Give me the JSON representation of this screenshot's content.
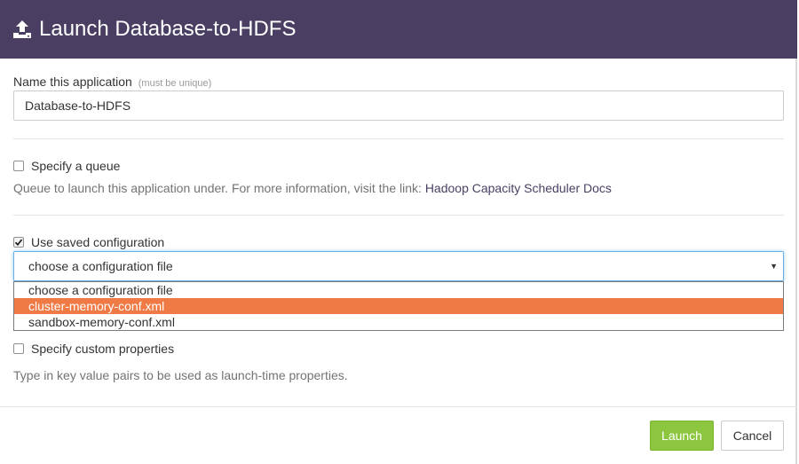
{
  "dialog": {
    "title": "Launch Database-to-HDFS",
    "icon": "upload-icon"
  },
  "name_field": {
    "label": "Name this application",
    "hint": "(must be unique)",
    "value": "Database-to-HDFS"
  },
  "queue": {
    "label": "Specify a queue",
    "checked": false,
    "help_text": "Queue to launch this application under. For more information, visit the link: ",
    "link_text": "Hadoop Capacity Scheduler Docs"
  },
  "saved_config": {
    "label": "Use saved configuration",
    "checked": true,
    "selected": "choose a configuration file",
    "options": [
      "choose a configuration file",
      "cluster-memory-conf.xml",
      "sandbox-memory-conf.xml"
    ],
    "highlighted_option": "cluster-memory-conf.xml"
  },
  "custom_props": {
    "label": "Specify custom properties",
    "checked": false,
    "help_text": "Type in key value pairs to be used as launch-time properties."
  },
  "footer": {
    "launch_label": "Launch",
    "cancel_label": "Cancel"
  },
  "colors": {
    "header_bg": "#4a3f63",
    "launch_bg": "#8cc63f",
    "highlight": "#ef7a45",
    "link": "#4a3f63"
  }
}
